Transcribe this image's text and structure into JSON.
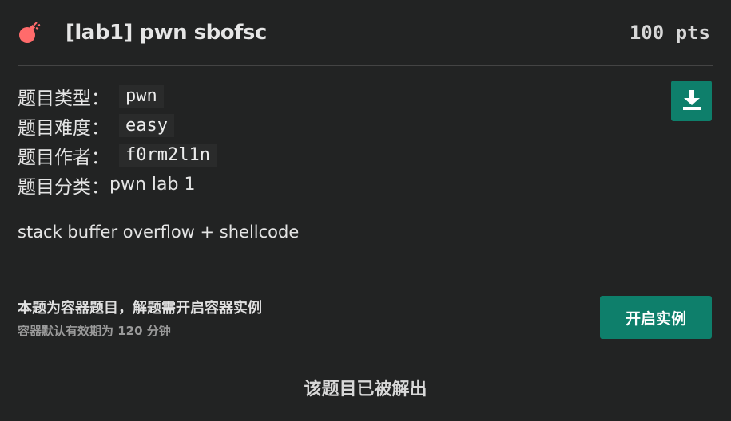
{
  "challenge": {
    "title": "[lab1] pwn sbofsc",
    "points": "100 pts",
    "icon": "bomb-icon"
  },
  "meta": {
    "type_label": "题目类型",
    "type_value": "pwn",
    "difficulty_label": "题目难度",
    "difficulty_value": "easy",
    "author_label": "题目作者",
    "author_value": "f0rm2l1n",
    "category_label": "题目分类",
    "category_value": "pwn lab 1",
    "separator": "："
  },
  "description": "stack buffer overflow + shellcode",
  "download": {
    "icon": "download-icon"
  },
  "container": {
    "title": "本题为容器题目，解题需开启容器实例",
    "subtitle": "容器默认有效期为 120 分钟",
    "start_label": "开启实例"
  },
  "status": {
    "solved_text": "该题目已被解出"
  },
  "colors": {
    "accent": "#0e7f6b",
    "bomb": "#ff6b6b",
    "background": "#222323"
  }
}
